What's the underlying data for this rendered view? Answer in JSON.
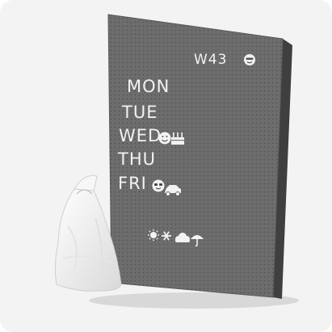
{
  "board": {
    "week": "W43",
    "days": [
      "MON",
      "TUE",
      "WED",
      "THU",
      "FRI"
    ]
  },
  "icons": [
    "smiley-icon",
    "cake-icon",
    "sunglasses-icon",
    "car-icon",
    "sun-icon",
    "snowflake-icon",
    "cloud-icon",
    "umbrella-icon"
  ],
  "colors": {
    "background": "#f3f3f3",
    "board": "#6b6b6b",
    "frame": "#4a4a4a",
    "letters": "#f2f2f2"
  }
}
